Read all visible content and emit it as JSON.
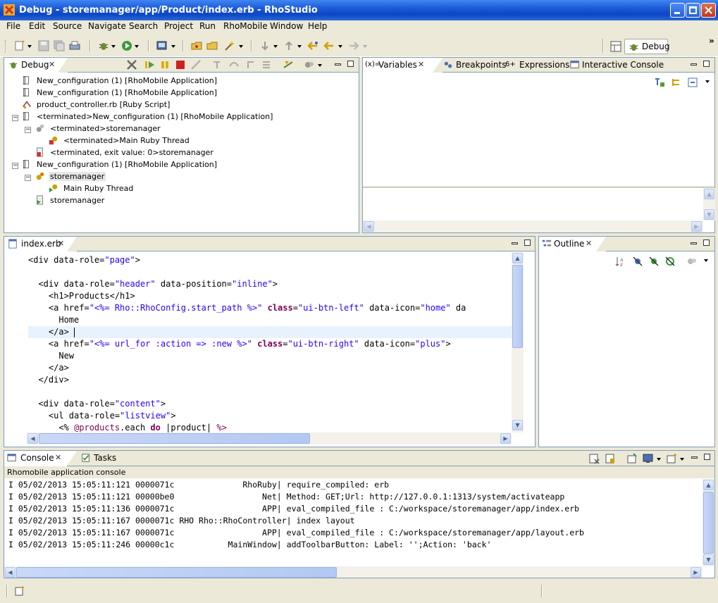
{
  "window": {
    "title": "Debug - storemanager/app/Product/index.erb - RhoStudio"
  },
  "menu": [
    "File",
    "Edit",
    "Source",
    "Navigate",
    "Search",
    "Project",
    "Run",
    "RhoMobile",
    "Window",
    "Help"
  ],
  "perspective": {
    "label": "Debug"
  },
  "debug_view": {
    "tab": "Debug",
    "items": [
      "New_configuration (1) [RhoMobile Application]",
      "New_configuration (1) [RhoMobile Application]",
      "product_controller.rb [Ruby Script]",
      "<terminated>New_configuration (1) [RhoMobile Application]",
      "<terminated>storemanager",
      "<terminated>Main Ruby Thread",
      "<terminated, exit value: 0>storemanager",
      "New_configuration (1) [RhoMobile Application]",
      "storemanager",
      "Main Ruby Thread",
      "storemanager"
    ]
  },
  "variables_view": {
    "tabs": [
      "Variables",
      "Breakpoints",
      "Expressions",
      "Interactive Console"
    ]
  },
  "editor": {
    "tab": "index.erb",
    "lines": [
      [
        [
          "t",
          "<div data-role="
        ],
        [
          "s",
          "\"page\""
        ],
        [
          "t",
          ">"
        ]
      ],
      [],
      [
        [
          "t",
          "  <div data-role="
        ],
        [
          "s",
          "\"header\""
        ],
        [
          "t",
          " data-position="
        ],
        [
          "s",
          "\"inline\""
        ],
        [
          "t",
          ">"
        ]
      ],
      [
        [
          "t",
          "    <h1>Products</h1>"
        ]
      ],
      [
        [
          "t",
          "    <a href="
        ],
        [
          "s",
          "\"<%= Rho::RhoConfig.start_path %>\""
        ],
        [
          "t",
          " "
        ],
        [
          "b",
          "class"
        ],
        [
          "t",
          "="
        ],
        [
          "s",
          "\"ui-btn-left\""
        ],
        [
          "t",
          " data-icon="
        ],
        [
          "s",
          "\"home\""
        ],
        [
          "t",
          " da"
        ]
      ],
      [
        [
          "t",
          "      Home"
        ]
      ],
      [
        [
          "t",
          "    </a>"
        ]
      ],
      [
        [
          "t",
          "    <a href="
        ],
        [
          "s",
          "\"<%= url_for :action => :new %>\""
        ],
        [
          "t",
          " "
        ],
        [
          "b",
          "class"
        ],
        [
          "t",
          "="
        ],
        [
          "s",
          "\"ui-btn-right\""
        ],
        [
          "t",
          " data-icon="
        ],
        [
          "s",
          "\"plus\""
        ],
        [
          "t",
          ">"
        ]
      ],
      [
        [
          "t",
          "      New"
        ]
      ],
      [
        [
          "t",
          "    </a>"
        ]
      ],
      [
        [
          "t",
          "  </div>"
        ]
      ],
      [],
      [
        [
          "t",
          "  <div data-role="
        ],
        [
          "s",
          "\"content\""
        ],
        [
          "t",
          ">"
        ]
      ],
      [
        [
          "t",
          "    <ul data-role="
        ],
        [
          "s",
          "\"listview\""
        ],
        [
          "t",
          ">"
        ]
      ],
      [
        [
          "t",
          "      <% "
        ],
        [
          "i",
          "@products"
        ],
        [
          "t",
          ".each "
        ],
        [
          "b",
          "do"
        ],
        [
          "t",
          " |product| "
        ],
        [
          "i",
          "%>"
        ]
      ]
    ]
  },
  "outline_view": {
    "tab": "Outline"
  },
  "console_view": {
    "tabs": [
      "Console",
      "Tasks"
    ],
    "header": "Rhomobile application console",
    "lines": [
      "I 05/02/2013 15:05:11:121 0000071c              RhoRuby| require_compiled: erb",
      "I 05/02/2013 15:05:11:121 00000be0                  Net| Method: GET;Url: http://127.0.0.1:1313/system/activateapp",
      "I 05/02/2013 15:05:11:136 0000071c                  APP| eval_compiled_file : C:/workspace/storemanager/app/index.erb",
      "I 05/02/2013 15:05:11:167 0000071c RHO Rho::RhoController| index layout",
      "I 05/02/2013 15:05:11:167 0000071c                  APP| eval_compiled_file : C:/workspace/storemanager/app/layout.erb",
      "I 05/02/2013 15:05:11:246 00000c1c           MainWindow| addToolbarButton: Label: '';Action: 'back'"
    ]
  }
}
